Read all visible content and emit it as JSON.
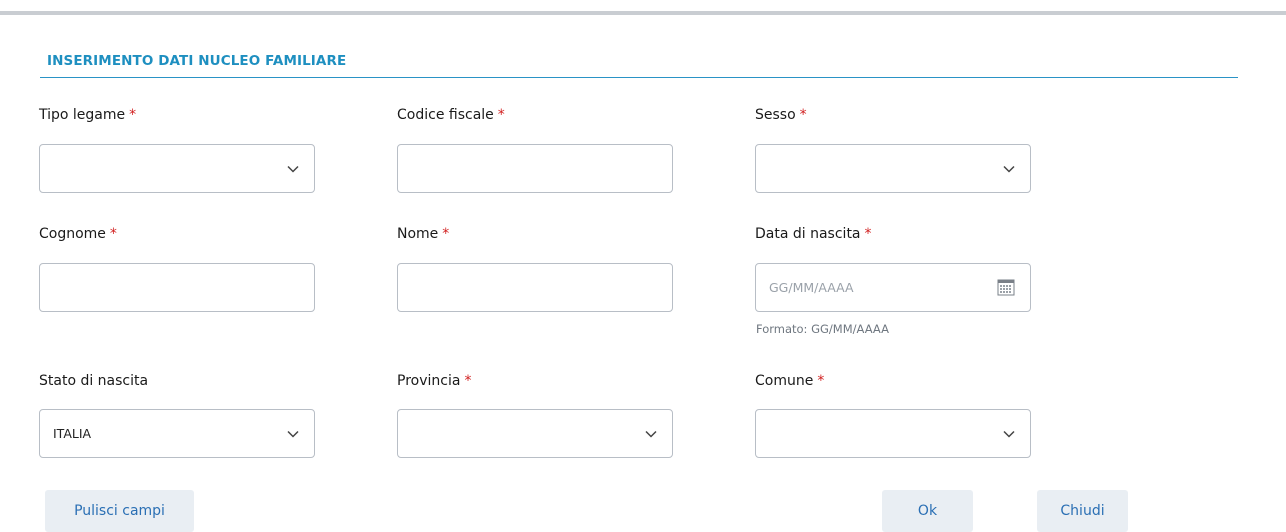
{
  "section": {
    "title": "INSERIMENTO DATI NUCLEO FAMILIARE"
  },
  "fields": {
    "tipo_legame": {
      "label": "Tipo legame",
      "required": "*",
      "value": ""
    },
    "codice_fiscale": {
      "label": "Codice fiscale",
      "required": "*",
      "value": ""
    },
    "sesso": {
      "label": "Sesso",
      "required": "*",
      "value": ""
    },
    "cognome": {
      "label": "Cognome",
      "required": "*",
      "value": ""
    },
    "nome": {
      "label": "Nome",
      "required": "*",
      "value": ""
    },
    "data_nascita": {
      "label": "Data di nascita",
      "required": "*",
      "placeholder": "GG/MM/AAAA",
      "hint": "Formato: GG/MM/AAAA"
    },
    "stato_nascita": {
      "label": "Stato di nascita",
      "value": "ITALIA"
    },
    "provincia": {
      "label": "Provincia",
      "required": "*",
      "value": ""
    },
    "comune": {
      "label": "Comune",
      "required": "*",
      "value": ""
    }
  },
  "buttons": {
    "clear": "Pulisci campi",
    "ok": "Ok",
    "close": "Chiudi"
  },
  "icons": {
    "select": "chevron-down-icon",
    "date": "calendar-icon"
  },
  "colors": {
    "accent": "#1e8fc0",
    "required": "#d11f1f",
    "button_bg": "#e9eef3",
    "button_text": "#2a6fb4"
  }
}
